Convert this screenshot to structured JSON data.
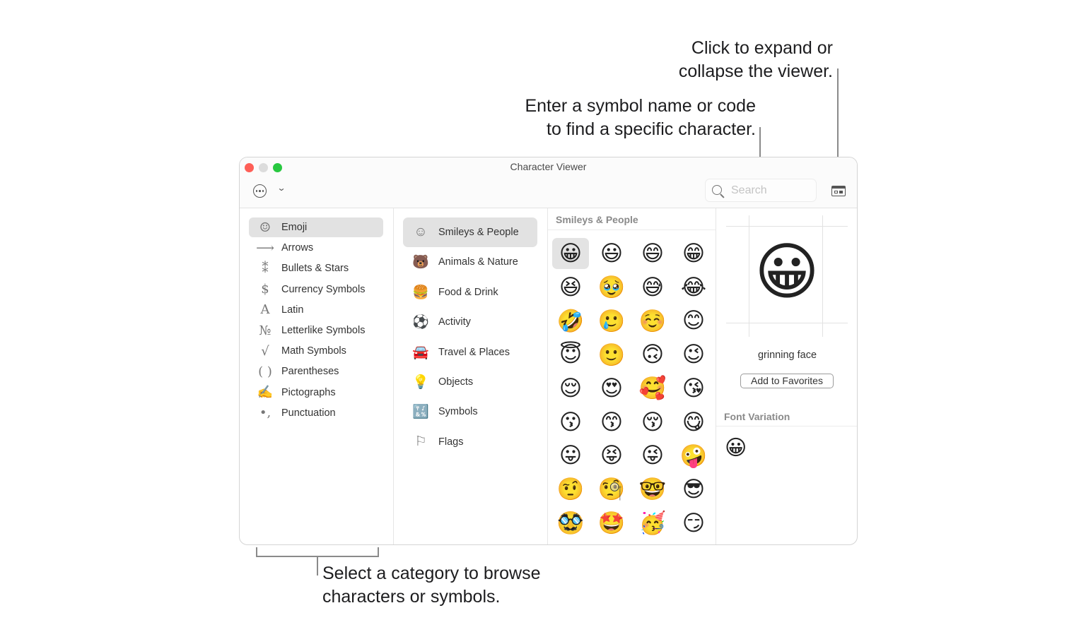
{
  "callouts": {
    "expand": [
      "Click to expand or",
      "collapse the viewer."
    ],
    "search": [
      "Enter a symbol name or code",
      "to find a specific character."
    ],
    "category": [
      "Select a category to browse",
      "characters or symbols."
    ]
  },
  "window": {
    "title": "Character Viewer",
    "traffic_colors": {
      "close": "#fe5f57",
      "minimize": "#dcdcdc",
      "zoom": "#28c840"
    },
    "toolbar": {
      "more_icon": "ellipsis-circle-icon",
      "dropdown_icon": "chevron-down-icon",
      "chevron_glyph": "⌄",
      "search_placeholder": "Search",
      "expand_icon": "sidebar-expand-icon"
    }
  },
  "categories": [
    {
      "label": "Emoji",
      "icon": "☺",
      "icon_name": "smiley-icon",
      "selected": true
    },
    {
      "label": "Arrows",
      "icon": "⟶",
      "icon_name": "arrow-icon"
    },
    {
      "label": "Bullets & Stars",
      "icon": "⁑",
      "icon_name": "asterisk-icon"
    },
    {
      "label": "Currency Symbols",
      "icon": "$",
      "icon_name": "dollar-icon"
    },
    {
      "label": "Latin",
      "icon": "A",
      "icon_name": "latin-a-icon"
    },
    {
      "label": "Letterlike Symbols",
      "icon": "№",
      "icon_name": "numero-icon"
    },
    {
      "label": "Math Symbols",
      "icon": "√",
      "icon_name": "square-root-icon"
    },
    {
      "label": "Parentheses",
      "icon": "( )",
      "icon_name": "parentheses-icon"
    },
    {
      "label": "Pictographs",
      "icon": "✍",
      "icon_name": "pictograph-icon"
    },
    {
      "label": "Punctuation",
      "icon": "•,",
      "icon_name": "punctuation-icon"
    }
  ],
  "subcategories": [
    {
      "label": "Smileys & People",
      "icon": "☺",
      "icon_name": "smiley-icon",
      "selected": true
    },
    {
      "label": "Animals & Nature",
      "icon": "🐻",
      "icon_name": "bear-icon"
    },
    {
      "label": "Food & Drink",
      "icon": "🍔",
      "icon_name": "burger-icon"
    },
    {
      "label": "Activity",
      "icon": "⚽",
      "icon_name": "soccer-ball-icon"
    },
    {
      "label": "Travel & Places",
      "icon": "🚘",
      "icon_name": "car-icon"
    },
    {
      "label": "Objects",
      "icon": "💡",
      "icon_name": "lightbulb-icon"
    },
    {
      "label": "Symbols",
      "icon": "🔣",
      "icon_name": "symbols-icon"
    },
    {
      "label": "Flags",
      "icon": "⚐",
      "icon_name": "flag-icon"
    }
  ],
  "grid": {
    "header": "Smileys & People",
    "emojis": [
      "😀",
      "😃",
      "😄",
      "😁",
      "😆",
      "🥹",
      "😅",
      "😂",
      "🤣",
      "🥲",
      "☺️",
      "😊",
      "😇",
      "🙂",
      "🙃",
      "😉",
      "😌",
      "😍",
      "🥰",
      "😘",
      "😗",
      "😙",
      "😚",
      "😋",
      "😛",
      "😝",
      "😜",
      "🤪",
      "🤨",
      "🧐",
      "🤓",
      "😎",
      "🥸",
      "🤩",
      "🥳",
      "😏"
    ],
    "selected_index": 0
  },
  "detail": {
    "glyph": "😀",
    "name": "grinning face",
    "add_favorites_label": "Add to Favorites",
    "font_variation_header": "Font Variation",
    "variations": [
      "😀"
    ]
  }
}
